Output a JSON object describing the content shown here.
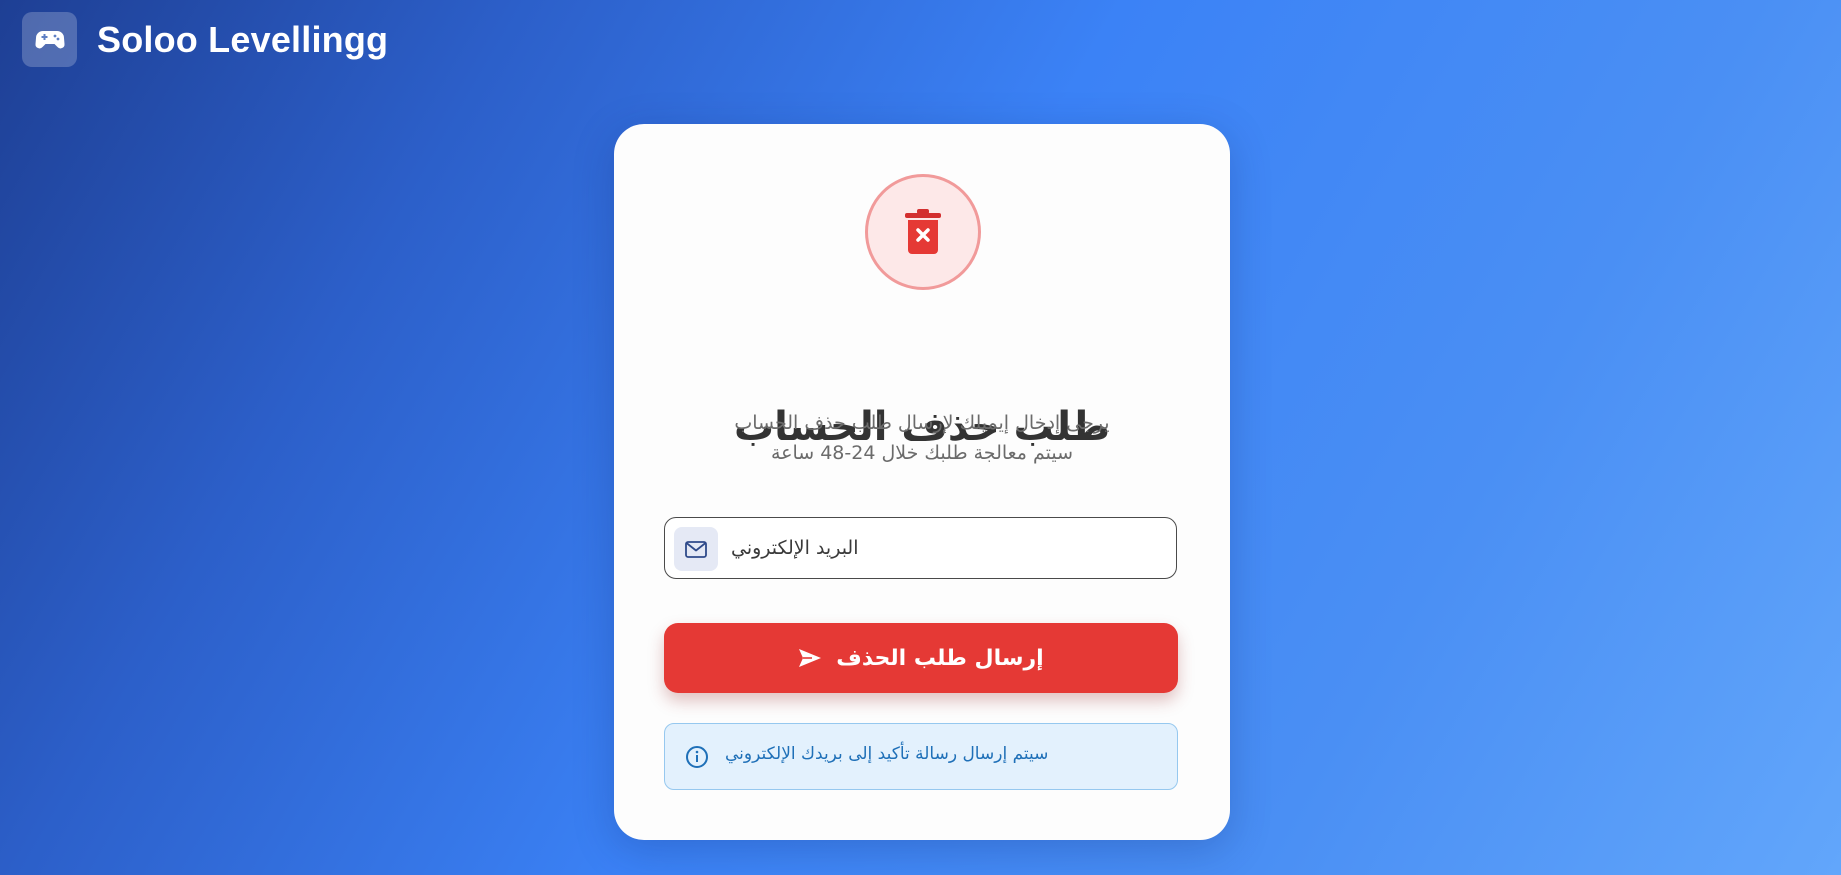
{
  "brand": {
    "name": "Soloo Levellingg",
    "logo_icon": "gamepad-icon"
  },
  "card": {
    "icon": "trash-x-icon",
    "title": "طلب حذف الحساب",
    "subtitle_line1": "يرجى إدخال إيميلك لإرسال طلب حذف الحساب",
    "subtitle_line2": "سيتم معالجة طلبك خلال 24-48 ساعة",
    "email": {
      "icon": "mail-icon",
      "placeholder": "البريد الإلكتروني",
      "value": ""
    },
    "submit": {
      "label": "إرسال طلب الحذف",
      "icon": "send-icon"
    },
    "info": {
      "icon": "info-icon",
      "text": "سيتم إرسال رسالة تأكيد إلى بريدك الإلكتروني"
    }
  },
  "colors": {
    "accent_red": "#e53935",
    "info_blue": "#1f70b8",
    "background_start": "#1e3f94",
    "background_end": "#62a6fb"
  }
}
